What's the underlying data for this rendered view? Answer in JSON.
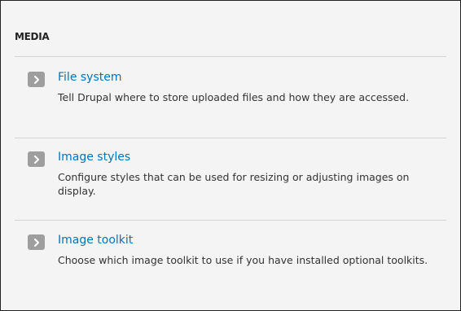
{
  "panel": {
    "title": "MEDIA",
    "items": [
      {
        "label": "File system",
        "description": "Tell Drupal where to store uploaded files and how they are accessed."
      },
      {
        "label": "Image styles",
        "description": "Configure styles that can be used for resizing or adjusting images on display."
      },
      {
        "label": "Image toolkit",
        "description": "Choose which image toolkit to use if you have installed optional toolkits."
      }
    ]
  },
  "colors": {
    "link": "#0074bd",
    "icon_background": "#9e9e9e",
    "panel_background": "#f4f4f4",
    "divider": "#d4d4d4"
  },
  "icons": {
    "item_icon": "chevron-right-icon"
  }
}
